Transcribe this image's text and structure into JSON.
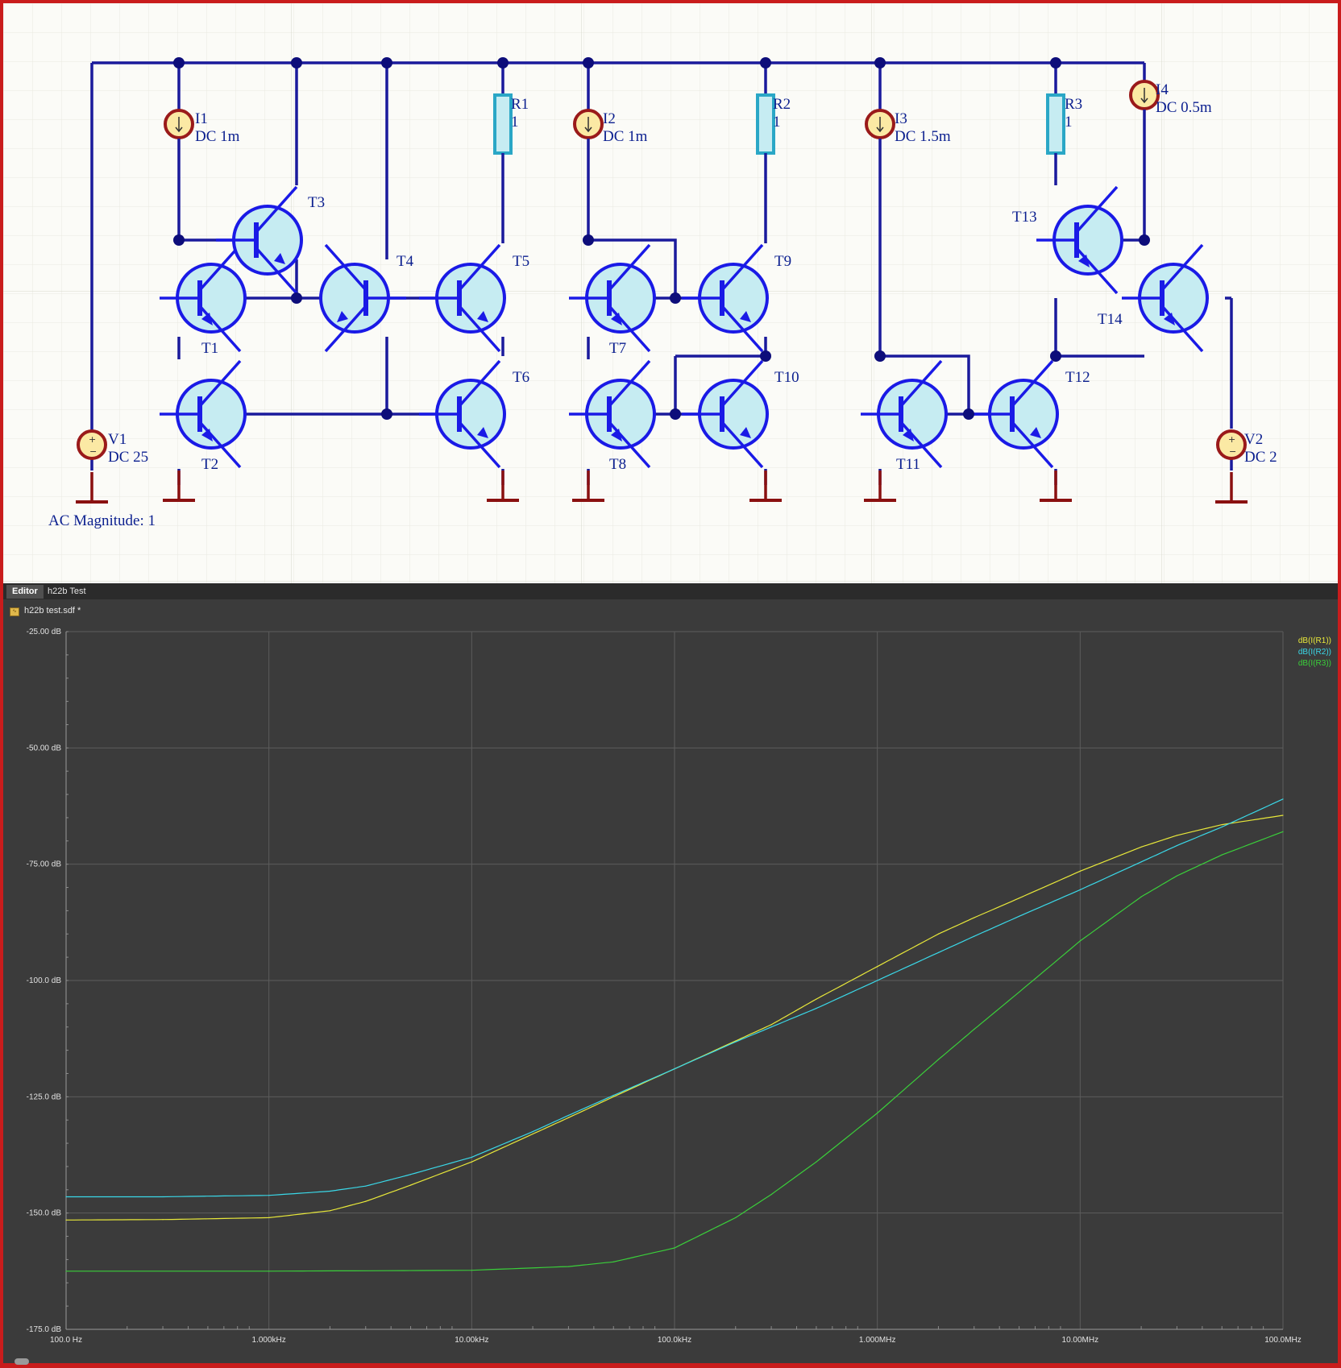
{
  "schematic": {
    "labels": {
      "T1": "T1",
      "T2": "T2",
      "T3": "T3",
      "T4": "T4",
      "T5": "T5",
      "T6": "T6",
      "T7": "T7",
      "T8": "T8",
      "T9": "T9",
      "T10": "T10",
      "T11": "T11",
      "T12": "T12",
      "T13": "T13",
      "T14": "T14",
      "I1": "I1",
      "I1v": "DC 1m",
      "I2": "I2",
      "I2v": "DC 1m",
      "I3": "I3",
      "I3v": "DC 1.5m",
      "I4": "I4",
      "I4v": "DC 0.5m",
      "R1": "R1",
      "R1v": "1",
      "R2": "R2",
      "R2v": "1",
      "R3": "R3",
      "R3v": "1",
      "V1": "V1",
      "V1v": "DC 25",
      "V2": "V2",
      "V2v": "DC 2",
      "ac": "AC Magnitude: 1"
    },
    "colors": {
      "wire": "#1a1a9c",
      "transistor_body": "#c6ecf2",
      "transistor_stroke": "#1a1ae6",
      "source_ring": "#9a1a1a",
      "source_fill": "#fbe9a4",
      "resistor_fill": "#c6ecf2",
      "resistor_stroke": "#2aa7c6",
      "ground": "#8a1010",
      "junction": "#0d0d7a"
    }
  },
  "tabs": [
    {
      "label": "Editor",
      "active": true
    },
    {
      "label": "h22b Test",
      "active": false
    }
  ],
  "document": {
    "title": "h22b test.sdf *",
    "icon": "waveform-doc-icon"
  },
  "chart_data": {
    "type": "line",
    "xscale": "log",
    "xlim": [
      100,
      100000000
    ],
    "ylim": [
      -175,
      -25
    ],
    "x_ticks": [
      "100.0 Hz",
      "1.000kHz",
      "10.00kHz",
      "100.0kHz",
      "1.000MHz",
      "10.00MHz",
      "100.0MHz"
    ],
    "y_ticks": [
      "-25.00 dB",
      "-50.00 dB",
      "-75.00 dB",
      "-100.0 dB",
      "-125.0 dB",
      "-150.0 dB",
      "-175.0 dB"
    ],
    "y_tick_values": [
      -25,
      -50,
      -75,
      -100,
      -125,
      -150,
      -175
    ],
    "grid": true,
    "legend_position": "top-right",
    "series": [
      {
        "name": "dB(I(R1))",
        "color": "#e8e83a",
        "x": [
          100,
          300,
          1000,
          2000,
          3000,
          5000,
          10000,
          20000,
          30000,
          50000,
          100000,
          200000,
          300000,
          500000,
          1000000,
          2000000,
          3000000,
          5000000,
          10000000,
          20000000,
          30000000,
          50000000,
          100000000
        ],
        "values": [
          -151.5,
          -151.4,
          -151,
          -149.5,
          -147.5,
          -144,
          -139,
          -133,
          -129.5,
          -125,
          -119,
          -113,
          -109.5,
          -104,
          -97,
          -90,
          -86.5,
          -82.3,
          -76.5,
          -71.3,
          -68.8,
          -66.5,
          -64.5
        ]
      },
      {
        "name": "dB(I(R2))",
        "color": "#3ad8e8",
        "x": [
          100,
          300,
          1000,
          2000,
          3000,
          5000,
          10000,
          20000,
          30000,
          50000,
          100000,
          200000,
          300000,
          500000,
          1000000,
          2000000,
          3000000,
          5000000,
          10000000,
          20000000,
          30000000,
          50000000,
          100000000
        ],
        "values": [
          -146.5,
          -146.5,
          -146.2,
          -145.3,
          -144.2,
          -141.7,
          -138,
          -132.5,
          -129,
          -124.7,
          -119,
          -113.2,
          -110,
          -106,
          -100,
          -94,
          -90.5,
          -86.2,
          -80.5,
          -74.5,
          -71,
          -67,
          -61
        ]
      },
      {
        "name": "dB(I(R3))",
        "color": "#3acf3a",
        "x": [
          100,
          1000,
          10000,
          30000,
          50000,
          100000,
          200000,
          300000,
          500000,
          1000000,
          2000000,
          3000000,
          5000000,
          10000000,
          20000000,
          30000000,
          50000000,
          100000000
        ],
        "values": [
          -162.5,
          -162.5,
          -162.3,
          -161.5,
          -160.5,
          -157.5,
          -151,
          -146,
          -139,
          -128.5,
          -117,
          -110.5,
          -102.5,
          -91.5,
          -82,
          -77.5,
          -73,
          -68
        ]
      }
    ]
  }
}
